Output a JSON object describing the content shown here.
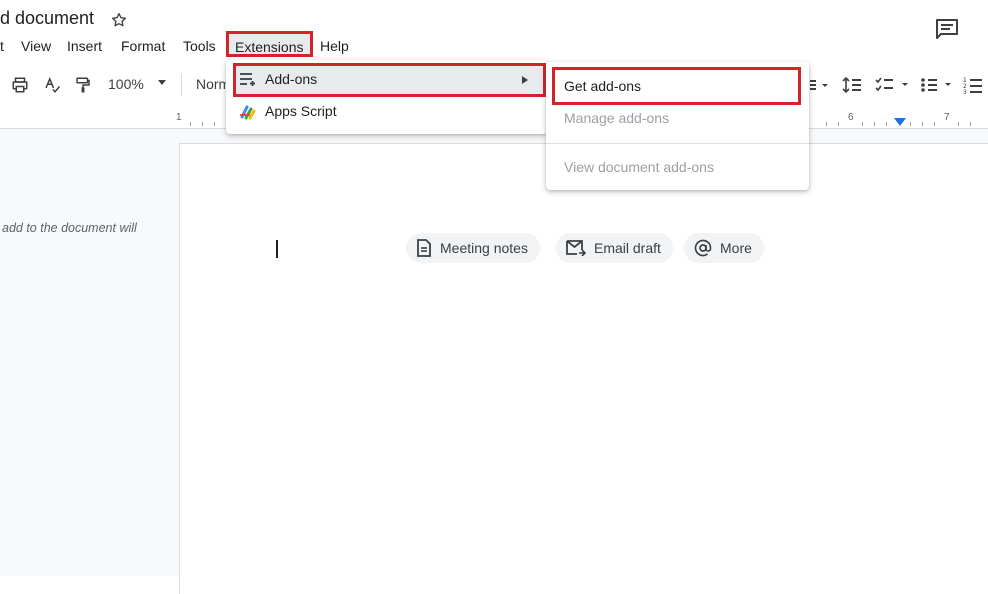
{
  "document": {
    "title": "d document",
    "outline_hint": "add to the document will"
  },
  "menubar": {
    "items": [
      {
        "label": "t"
      },
      {
        "label": "View"
      },
      {
        "label": "Insert"
      },
      {
        "label": "Format"
      },
      {
        "label": "Tools"
      },
      {
        "label": "Extensions"
      },
      {
        "label": "Help"
      }
    ]
  },
  "toolbar": {
    "zoom": "100%",
    "style": "Norm"
  },
  "ruler": {
    "numbers": [
      "1",
      "6",
      "7"
    ]
  },
  "extensions_menu": {
    "addons_label": "Add-ons",
    "apps_script_label": "Apps Script"
  },
  "addons_submenu": {
    "get_addons_label": "Get add-ons",
    "manage_addons_label": "Manage add-ons",
    "view_document_addons_label": "View document add-ons"
  },
  "smart_chips": [
    {
      "label": "Meeting notes",
      "icon": "document-icon"
    },
    {
      "label": "Email draft",
      "icon": "email-icon"
    },
    {
      "label": "More",
      "icon": "at-sign-icon"
    }
  ],
  "colors": {
    "highlight_border": "#d2232a",
    "menu_hover": "#e8eaed",
    "chip_background": "#f1f3f4",
    "disabled_text": "#9aa0a6"
  }
}
